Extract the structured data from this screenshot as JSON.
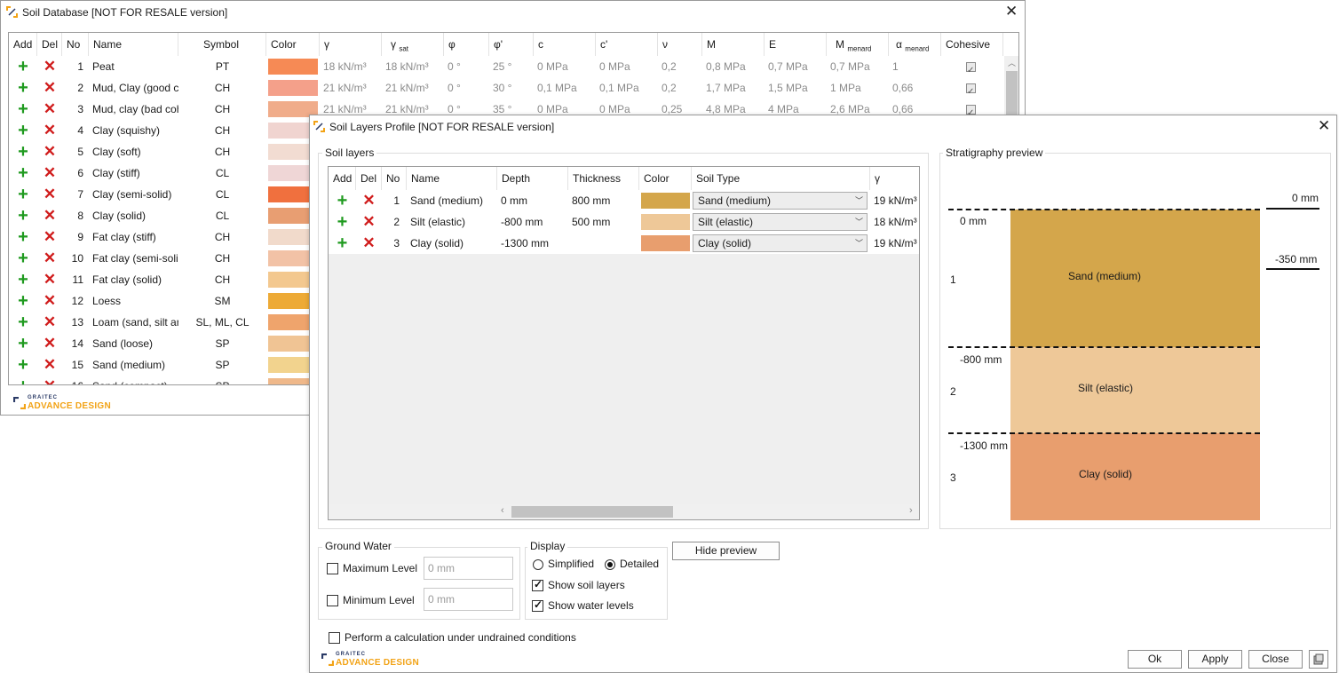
{
  "soil_db": {
    "title": "Soil Database [NOT FOR RESALE version]",
    "columns": [
      "Add",
      "Del",
      "No",
      "Name",
      "Symbol",
      "Color",
      "γ",
      "γ",
      "sat",
      "φ",
      "φ'",
      "c",
      "c'",
      "ν",
      "M",
      "E",
      "M",
      "menard",
      "α",
      "menard",
      "Cohesive"
    ],
    "rows": [
      {
        "no": "1",
        "name": "Peat",
        "symbol": "PT",
        "color": "#F68A55",
        "g": "18 kN/m³",
        "gsat": "18 kN/m³",
        "phi": "0 °",
        "phip": "25 °",
        "c": "0 MPa",
        "cp": "0 MPa",
        "nu": "0,2",
        "m": "0,8 MPa",
        "e": "0,7 MPa",
        "mm": "0,7 MPa",
        "am": "1"
      },
      {
        "no": "2",
        "name": "Mud, Clay (good co",
        "symbol": "CH",
        "color": "#F4A08A",
        "g": "21 kN/m³",
        "gsat": "21 kN/m³",
        "phi": "0 °",
        "phip": "30 °",
        "c": "0,1 MPa",
        "cp": "0,1 MPa",
        "nu": "0,2",
        "m": "1,7 MPa",
        "e": "1,5 MPa",
        "mm": "1 MPa",
        "am": "0,66"
      },
      {
        "no": "3",
        "name": "Mud, clay (bad coh",
        "symbol": "CH",
        "color": "#F0AC8A",
        "g": "21 kN/m³",
        "gsat": "21 kN/m³",
        "phi": "0 °",
        "phip": "35 °",
        "c": "0 MPa",
        "cp": "0 MPa",
        "nu": "0,25",
        "m": "4,8 MPa",
        "e": "4 MPa",
        "mm": "2,6 MPa",
        "am": "0,66"
      },
      {
        "no": "4",
        "name": "Clay (squishy)",
        "symbol": "CH",
        "color": "#F0D4D0"
      },
      {
        "no": "5",
        "name": "Clay (soft)",
        "symbol": "CH",
        "color": "#F2DCD2"
      },
      {
        "no": "6",
        "name": "Clay (stiff)",
        "symbol": "CL",
        "color": "#EFD6D6"
      },
      {
        "no": "7",
        "name": "Clay (semi-solid)",
        "symbol": "CL",
        "color": "#F0703E"
      },
      {
        "no": "8",
        "name": "Clay (solid)",
        "symbol": "CL",
        "color": "#E89E72"
      },
      {
        "no": "9",
        "name": "Fat clay (stiff)",
        "symbol": "CH",
        "color": "#F1DACB"
      },
      {
        "no": "10",
        "name": "Fat clay (semi-solic",
        "symbol": "CH",
        "color": "#F2C2A6"
      },
      {
        "no": "11",
        "name": "Fat clay (solid)",
        "symbol": "CH",
        "color": "#F3C88F"
      },
      {
        "no": "12",
        "name": "Loess",
        "symbol": "SM",
        "color": "#EDAA36"
      },
      {
        "no": "13",
        "name": "Loam (sand, silt an",
        "symbol": "SL, ML, CL",
        "color": "#EFA46C"
      },
      {
        "no": "14",
        "name": "Sand (loose)",
        "symbol": "SP",
        "color": "#F0C494"
      },
      {
        "no": "15",
        "name": "Sand (medium)",
        "symbol": "SP",
        "color": "#F2D38E"
      },
      {
        "no": "16",
        "name": "Sand (compact)",
        "symbol": "SP",
        "color": "#EFB88A"
      }
    ],
    "logo_top": "GRAITEC",
    "logo_bottom": "ADVANCE DESIGN"
  },
  "profile": {
    "title": "Soil Layers Profile [NOT FOR RESALE version]",
    "soil_layers_label": "Soil layers",
    "columns": [
      "Add",
      "Del",
      "No",
      "Name",
      "Depth",
      "Thickness",
      "Color",
      "Soil Type",
      "γ"
    ],
    "layers": [
      {
        "no": "1",
        "name": "Sand (medium)",
        "depth": "0 mm",
        "thickness": "800 mm",
        "color": "#D4A64B",
        "soil_type": "Sand (medium)",
        "g": "19 kN/m³"
      },
      {
        "no": "2",
        "name": "Silt (elastic)",
        "depth": "-800 mm",
        "thickness": "500 mm",
        "color": "#EEC898",
        "soil_type": "Silt (elastic)",
        "g": "18 kN/m³"
      },
      {
        "no": "3",
        "name": "Clay (solid)",
        "depth": "-1300 mm",
        "thickness": "",
        "color": "#E89E6E",
        "soil_type": "Clay (solid)",
        "g": "19 kN/m³"
      }
    ],
    "ground_water": {
      "label": "Ground Water",
      "max_label": "Maximum Level",
      "max_value": "0 mm",
      "min_label": "Minimum Level",
      "min_value": "0 mm"
    },
    "display": {
      "label": "Display",
      "simplified": "Simplified",
      "detailed": "Detailed",
      "show_soil_layers": "Show soil layers",
      "show_water_levels": "Show water levels"
    },
    "hide_preview": "Hide preview",
    "undrained": "Perform a calculation under undrained conditions",
    "ok": "Ok",
    "apply": "Apply",
    "close": "Close",
    "preview": {
      "label": "Stratigraphy preview",
      "top_right_1": "0 mm",
      "top_right_2": "-350 mm",
      "depths": [
        "0 mm",
        "-800 mm",
        "-1300 mm"
      ],
      "numbers": [
        "1",
        "2",
        "3"
      ],
      "layer_names": [
        "Sand (medium)",
        "Silt (elastic)",
        "Clay (solid)"
      ]
    },
    "logo_top": "GRAITEC",
    "logo_bottom": "ADVANCE DESIGN"
  }
}
